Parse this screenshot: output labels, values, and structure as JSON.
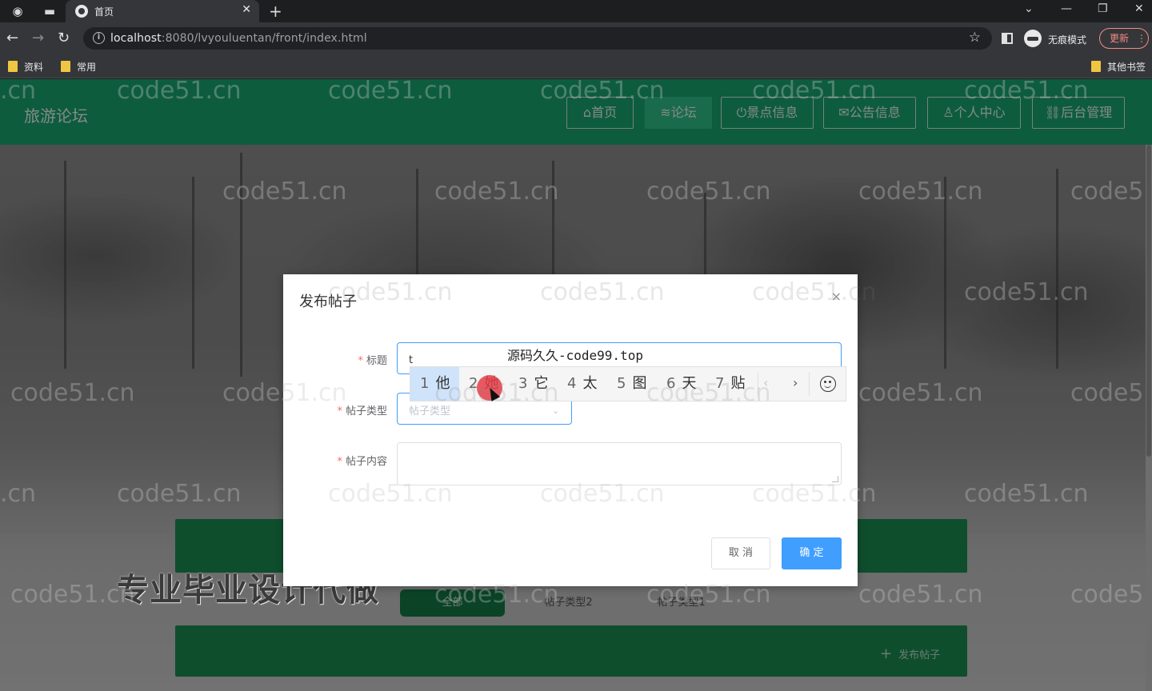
{
  "browser": {
    "tab_title": "首页",
    "url_host": "localhost",
    "url_rest": ":8080/lvyouluentan/front/index.html",
    "incognito_label": "无痕模式",
    "update_label": "更新",
    "bookmarks": [
      "资料",
      "常用"
    ],
    "other_bookmarks": "其他书签"
  },
  "site": {
    "title": "旅游论坛",
    "nav": [
      {
        "icon": "home-icon",
        "label": "首页",
        "glyph": "⌂"
      },
      {
        "icon": "layers-icon",
        "label": "论坛",
        "glyph": "≋"
      },
      {
        "icon": "power-icon",
        "label": "景点信息",
        "glyph": "⏻"
      },
      {
        "icon": "mail-icon",
        "label": "公告信息",
        "glyph": "✉"
      },
      {
        "icon": "user-icon",
        "label": "个人中心",
        "glyph": "♙"
      },
      {
        "icon": "link-icon",
        "label": "后台管理",
        "glyph": "⛓"
      }
    ],
    "active_nav": "论坛"
  },
  "forum": {
    "filters": [
      "全部",
      "帖子类型2",
      "帖子类型1"
    ],
    "active_filter": "全部",
    "post_button": "发布帖子"
  },
  "promo_text": "专业毕业设计代做",
  "dialog": {
    "title": "发布帖子",
    "fields": {
      "title_label": "标题",
      "title_value": "t",
      "type_label": "帖子类型",
      "type_placeholder": "帖子类型",
      "content_label": "帖子内容",
      "content_value": ""
    },
    "cancel_label": "取 消",
    "ok_label": "确 定"
  },
  "ime": {
    "composition": "源码久久-code99.top",
    "candidates": [
      {
        "num": "1",
        "char": "他"
      },
      {
        "num": "2",
        "char": "她"
      },
      {
        "num": "3",
        "char": "它"
      },
      {
        "num": "4",
        "char": "太"
      },
      {
        "num": "5",
        "char": "图"
      },
      {
        "num": "6",
        "char": "天"
      },
      {
        "num": "7",
        "char": "贴"
      }
    ],
    "selected_index": 0
  },
  "watermark": "code51.cn",
  "watermark_partial_left": ".cn",
  "watermark_partial_right": "code5",
  "colors": {
    "header_green": "#18a871",
    "nav_active": "#2fc38a",
    "primary_blue": "#409eff",
    "forum_bar_green": "#1b8e52"
  }
}
